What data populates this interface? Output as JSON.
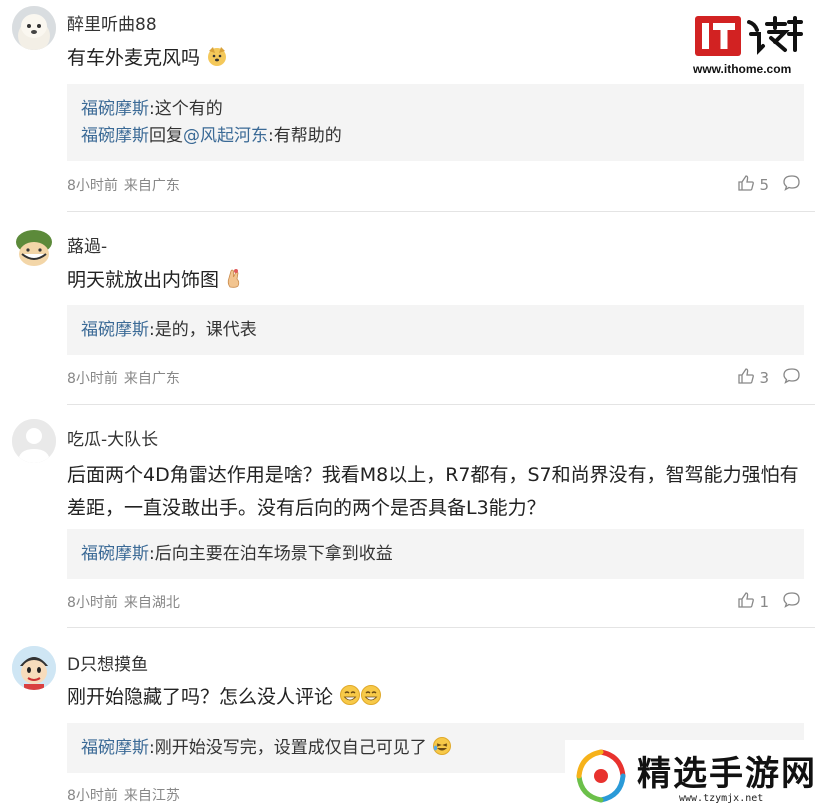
{
  "site": {
    "logo_text": "IT之家",
    "url": "www.ithome.com"
  },
  "comments": [
    {
      "username": "醉里听曲88",
      "content": "有车外麦克风吗",
      "content_emoji": "dog-face-emoji",
      "replies": [
        {
          "author": "福碗摩斯",
          "text": ":这个有的"
        },
        {
          "author": "福碗摩斯",
          "prefix": "回复",
          "mention": "@风起河东",
          "text": ":有帮助的"
        }
      ],
      "time": "8小时前",
      "location": "来自广东",
      "likes": "5"
    },
    {
      "username": "蕗過-",
      "content": "明天就放出内饰图",
      "content_emoji": "fingers-crossed-emoji",
      "replies": [
        {
          "author": "福碗摩斯",
          "text": ":是的，课代表"
        }
      ],
      "time": "8小时前",
      "location": "来自广东",
      "likes": "3"
    },
    {
      "username": "吃瓜-大队长",
      "content": "后面两个4D角雷达作用是啥？我看M8以上，R7都有，S7和尚界没有，智驾能力强怕有差距，一直没敢出手。没有后向的两个是否具备L3能力？",
      "replies": [
        {
          "author": "福碗摩斯",
          "text": ":后向主要在泊车场景下拿到收益"
        }
      ],
      "time": "8小时前",
      "location": "来自湖北",
      "likes": "1"
    },
    {
      "username": "D只想摸鱼",
      "content": "刚开始隐藏了吗？怎么没人评论",
      "content_emoji": "grinning-face-emoji",
      "replies": [
        {
          "author": "福碗摩斯",
          "text": ":刚开始没写完，设置成仅自己可见了"
        }
      ],
      "time": "8小时前",
      "location": "来自江苏"
    }
  ],
  "watermark": {
    "title": "精选手游网",
    "url": "www.tzymjx.net"
  },
  "colors": {
    "link": "#3b6a96",
    "reply_bg": "#f4f4f4",
    "meta": "#888888",
    "ithome_red": "#d22222"
  }
}
